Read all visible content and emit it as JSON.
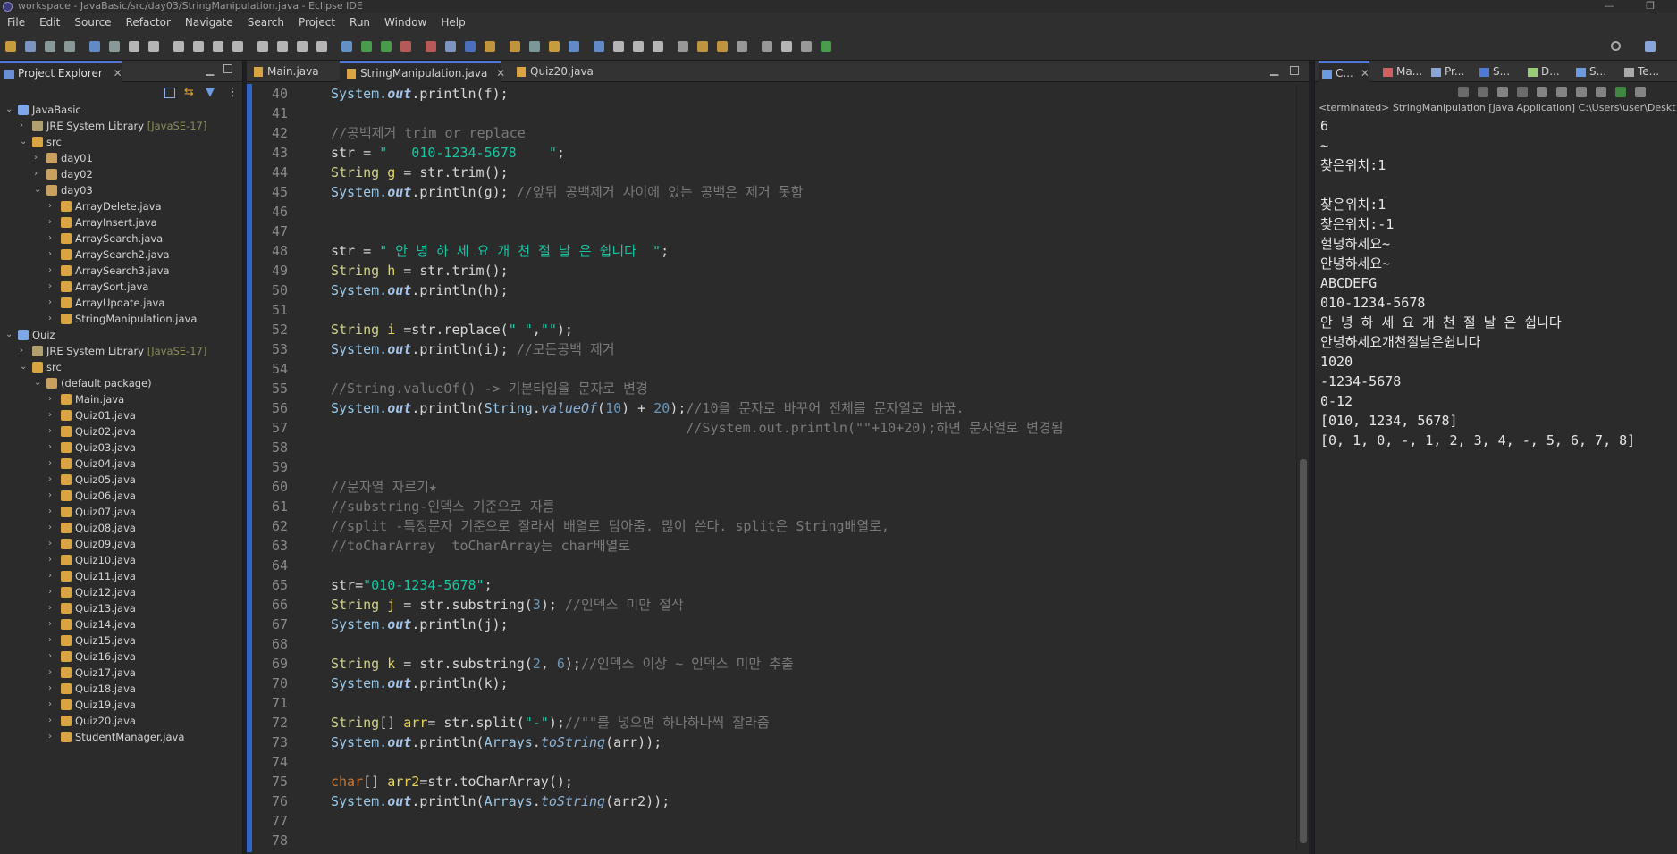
{
  "window": {
    "title": "workspace - JavaBasic/src/day03/StringManipulation.java - Eclipse IDE",
    "minimize_glyph": "—",
    "restore_glyph": "❐"
  },
  "menu": [
    "File",
    "Edit",
    "Source",
    "Refactor",
    "Navigate",
    "Search",
    "Project",
    "Run",
    "Window",
    "Help"
  ],
  "project_explorer": {
    "title": "Project Explorer",
    "tree": [
      {
        "label": "JavaBasic",
        "indent": 0,
        "arrow": "v",
        "icon": "project"
      },
      {
        "label": "JRE System Library",
        "suffix": "[JavaSE-17]",
        "indent": 1,
        "arrow": ">",
        "icon": "library"
      },
      {
        "label": "src",
        "indent": 1,
        "arrow": "v",
        "icon": "folder"
      },
      {
        "label": "day01",
        "indent": 2,
        "arrow": ">",
        "icon": "package"
      },
      {
        "label": "day02",
        "indent": 2,
        "arrow": ">",
        "icon": "package"
      },
      {
        "label": "day03",
        "indent": 2,
        "arrow": "v",
        "icon": "package"
      },
      {
        "label": "ArrayDelete.java",
        "indent": 3,
        "arrow": ">",
        "icon": "java"
      },
      {
        "label": "ArrayInsert.java",
        "indent": 3,
        "arrow": ">",
        "icon": "java"
      },
      {
        "label": "ArraySearch.java",
        "indent": 3,
        "arrow": ">",
        "icon": "java"
      },
      {
        "label": "ArraySearch2.java",
        "indent": 3,
        "arrow": ">",
        "icon": "java"
      },
      {
        "label": "ArraySearch3.java",
        "indent": 3,
        "arrow": ">",
        "icon": "java"
      },
      {
        "label": "ArraySort.java",
        "indent": 3,
        "arrow": ">",
        "icon": "java"
      },
      {
        "label": "ArrayUpdate.java",
        "indent": 3,
        "arrow": ">",
        "icon": "java"
      },
      {
        "label": "StringManipulation.java",
        "indent": 3,
        "arrow": ">",
        "icon": "java"
      },
      {
        "label": "Quiz",
        "indent": 0,
        "arrow": "v",
        "icon": "project"
      },
      {
        "label": "JRE System Library",
        "suffix": "[JavaSE-17]",
        "indent": 1,
        "arrow": ">",
        "icon": "library"
      },
      {
        "label": "src",
        "indent": 1,
        "arrow": "v",
        "icon": "folder"
      },
      {
        "label": "(default package)",
        "indent": 2,
        "arrow": "v",
        "icon": "package"
      },
      {
        "label": "Main.java",
        "indent": 3,
        "arrow": ">",
        "icon": "java"
      },
      {
        "label": "Quiz01.java",
        "indent": 3,
        "arrow": ">",
        "icon": "java"
      },
      {
        "label": "Quiz02.java",
        "indent": 3,
        "arrow": ">",
        "icon": "java"
      },
      {
        "label": "Quiz03.java",
        "indent": 3,
        "arrow": ">",
        "icon": "java"
      },
      {
        "label": "Quiz04.java",
        "indent": 3,
        "arrow": ">",
        "icon": "java"
      },
      {
        "label": "Quiz05.java",
        "indent": 3,
        "arrow": ">",
        "icon": "java"
      },
      {
        "label": "Quiz06.java",
        "indent": 3,
        "arrow": ">",
        "icon": "java"
      },
      {
        "label": "Quiz07.java",
        "indent": 3,
        "arrow": ">",
        "icon": "java"
      },
      {
        "label": "Quiz08.java",
        "indent": 3,
        "arrow": ">",
        "icon": "java"
      },
      {
        "label": "Quiz09.java",
        "indent": 3,
        "arrow": ">",
        "icon": "java"
      },
      {
        "label": "Quiz10.java",
        "indent": 3,
        "arrow": ">",
        "icon": "java"
      },
      {
        "label": "Quiz11.java",
        "indent": 3,
        "arrow": ">",
        "icon": "java"
      },
      {
        "label": "Quiz12.java",
        "indent": 3,
        "arrow": ">",
        "icon": "java"
      },
      {
        "label": "Quiz13.java",
        "indent": 3,
        "arrow": ">",
        "icon": "java"
      },
      {
        "label": "Quiz14.java",
        "indent": 3,
        "arrow": ">",
        "icon": "java"
      },
      {
        "label": "Quiz15.java",
        "indent": 3,
        "arrow": ">",
        "icon": "java"
      },
      {
        "label": "Quiz16.java",
        "indent": 3,
        "arrow": ">",
        "icon": "java"
      },
      {
        "label": "Quiz17.java",
        "indent": 3,
        "arrow": ">",
        "icon": "java"
      },
      {
        "label": "Quiz18.java",
        "indent": 3,
        "arrow": ">",
        "icon": "java"
      },
      {
        "label": "Quiz19.java",
        "indent": 3,
        "arrow": ">",
        "icon": "java"
      },
      {
        "label": "Quiz20.java",
        "indent": 3,
        "arrow": ">",
        "icon": "java"
      },
      {
        "label": "StudentManager.java",
        "indent": 3,
        "arrow": ">",
        "icon": "java"
      }
    ]
  },
  "editor": {
    "tabs": [
      {
        "label": "Main.java",
        "active": false
      },
      {
        "label": "StringManipulation.java",
        "active": true
      },
      {
        "label": "Quiz20.java",
        "active": false
      }
    ],
    "lines": [
      {
        "n": "40",
        "segs": [
          [
            "o",
            "System."
          ],
          [
            "out",
            "out"
          ],
          [
            "d",
            ".println(f);"
          ]
        ]
      },
      {
        "n": "41",
        "segs": []
      },
      {
        "n": "42",
        "segs": [
          [
            "c",
            "//공백제거 trim or replace"
          ]
        ]
      },
      {
        "n": "43",
        "segs": [
          [
            "d",
            "str = "
          ],
          [
            "s",
            "\"   010-1234-5678    \""
          ],
          [
            "d",
            ";"
          ]
        ]
      },
      {
        "n": "44",
        "segs": [
          [
            "t",
            "String"
          ],
          [
            "d",
            " "
          ],
          [
            "v",
            "g"
          ],
          [
            "d",
            " = str.trim();"
          ]
        ]
      },
      {
        "n": "45",
        "segs": [
          [
            "o",
            "System."
          ],
          [
            "out",
            "out"
          ],
          [
            "d",
            ".println(g); "
          ],
          [
            "c",
            "//앞뒤 공백제거 사이에 있는 공백은 제거 못함"
          ]
        ]
      },
      {
        "n": "46",
        "segs": []
      },
      {
        "n": "47",
        "segs": []
      },
      {
        "n": "48",
        "segs": [
          [
            "d",
            "str = "
          ],
          [
            "s",
            "\" 안 녕 하 세 요 개 천 절 날 은 쉽니다  \""
          ],
          [
            "d",
            ";"
          ]
        ]
      },
      {
        "n": "49",
        "segs": [
          [
            "t",
            "String"
          ],
          [
            "d",
            " "
          ],
          [
            "v",
            "h"
          ],
          [
            "d",
            " = str.trim();"
          ]
        ]
      },
      {
        "n": "50",
        "segs": [
          [
            "o",
            "System."
          ],
          [
            "out",
            "out"
          ],
          [
            "d",
            ".println(h);"
          ]
        ]
      },
      {
        "n": "51",
        "segs": []
      },
      {
        "n": "52",
        "segs": [
          [
            "t",
            "String"
          ],
          [
            "d",
            " "
          ],
          [
            "v",
            "i"
          ],
          [
            "d",
            " =str.replace("
          ],
          [
            "s",
            "\" \""
          ],
          [
            "d",
            ","
          ],
          [
            "s",
            "\"\""
          ],
          [
            "d",
            ");"
          ]
        ]
      },
      {
        "n": "53",
        "segs": [
          [
            "o",
            "System."
          ],
          [
            "out",
            "out"
          ],
          [
            "d",
            ".println(i); "
          ],
          [
            "c",
            "//모든공백 제거"
          ]
        ]
      },
      {
        "n": "54",
        "segs": []
      },
      {
        "n": "55",
        "segs": [
          [
            "c",
            "//String.valueOf() -> 기본타입을 문자로 변경"
          ]
        ]
      },
      {
        "n": "56",
        "segs": [
          [
            "o",
            "System."
          ],
          [
            "out",
            "out"
          ],
          [
            "d",
            ".println("
          ],
          [
            "k",
            "String"
          ],
          [
            "d",
            "."
          ],
          [
            "m",
            "valueOf"
          ],
          [
            "d",
            "("
          ],
          [
            "num",
            "10"
          ],
          [
            "d",
            ") + "
          ],
          [
            "num",
            "20"
          ],
          [
            "d",
            ");"
          ],
          [
            "c",
            "//10을 문자로 바꾸어 전체를 문자열로 바꿈."
          ]
        ]
      },
      {
        "n": "57",
        "segs": [
          [
            "d",
            "                                            "
          ],
          [
            "c",
            "//System.out.println(\"\"+10+20);하면 문자열로 변경됨"
          ]
        ]
      },
      {
        "n": "58",
        "segs": []
      },
      {
        "n": "59",
        "segs": []
      },
      {
        "n": "60",
        "segs": [
          [
            "c",
            "//문자열 자르기★"
          ]
        ]
      },
      {
        "n": "61",
        "segs": [
          [
            "c",
            "//substring-인덱스 기준으로 자름"
          ]
        ]
      },
      {
        "n": "62",
        "segs": [
          [
            "c",
            "//split -특정문자 기준으로 잘라서 배열로 담아줌. 많이 쓴다. split은 String배열로,"
          ]
        ]
      },
      {
        "n": "63",
        "segs": [
          [
            "c",
            "//toCharArray  toCharArray는 char배열로"
          ]
        ]
      },
      {
        "n": "64",
        "segs": []
      },
      {
        "n": "65",
        "segs": [
          [
            "d",
            "str="
          ],
          [
            "s",
            "\"010-1234-5678\""
          ],
          [
            "d",
            ";"
          ]
        ]
      },
      {
        "n": "66",
        "segs": [
          [
            "t",
            "String"
          ],
          [
            "d",
            " "
          ],
          [
            "v",
            "j"
          ],
          [
            "d",
            " = str.substring("
          ],
          [
            "num",
            "3"
          ],
          [
            "d",
            "); "
          ],
          [
            "c",
            "//인덱스 미만 절삭"
          ]
        ]
      },
      {
        "n": "67",
        "segs": [
          [
            "o",
            "System."
          ],
          [
            "out",
            "out"
          ],
          [
            "d",
            ".println(j);"
          ]
        ]
      },
      {
        "n": "68",
        "segs": []
      },
      {
        "n": "69",
        "segs": [
          [
            "t",
            "String"
          ],
          [
            "d",
            " "
          ],
          [
            "v",
            "k"
          ],
          [
            "d",
            " = str.substring("
          ],
          [
            "num",
            "2"
          ],
          [
            "d",
            ", "
          ],
          [
            "num",
            "6"
          ],
          [
            "d",
            ");"
          ],
          [
            "c",
            "//인덱스 이상 ~ 인덱스 미만 추출"
          ]
        ]
      },
      {
        "n": "70",
        "segs": [
          [
            "o",
            "System."
          ],
          [
            "out",
            "out"
          ],
          [
            "d",
            ".println(k);"
          ]
        ]
      },
      {
        "n": "71",
        "segs": []
      },
      {
        "n": "72",
        "segs": [
          [
            "t",
            "String"
          ],
          [
            "d",
            "[] "
          ],
          [
            "v",
            "arr"
          ],
          [
            "d",
            "= str.split("
          ],
          [
            "s",
            "\"-\""
          ],
          [
            "d",
            ");"
          ],
          [
            "c",
            "//\"\"를 넣으면 하나하나씩 잘라줌"
          ]
        ]
      },
      {
        "n": "73",
        "segs": [
          [
            "o",
            "System."
          ],
          [
            "out",
            "out"
          ],
          [
            "d",
            ".println("
          ],
          [
            "k",
            "Arrays"
          ],
          [
            "d",
            "."
          ],
          [
            "m",
            "toString"
          ],
          [
            "d",
            "(arr));"
          ]
        ]
      },
      {
        "n": "74",
        "segs": []
      },
      {
        "n": "75",
        "segs": [
          [
            "kw",
            "char"
          ],
          [
            "d",
            "[] "
          ],
          [
            "v",
            "arr2"
          ],
          [
            "d",
            "=str.toCharArray();"
          ]
        ]
      },
      {
        "n": "76",
        "segs": [
          [
            "o",
            "System."
          ],
          [
            "out",
            "out"
          ],
          [
            "d",
            ".println("
          ],
          [
            "k",
            "Arrays"
          ],
          [
            "d",
            "."
          ],
          [
            "m",
            "toString"
          ],
          [
            "d",
            "(arr2));"
          ]
        ]
      },
      {
        "n": "77",
        "segs": []
      },
      {
        "n": "78",
        "segs": []
      }
    ]
  },
  "console": {
    "tabs": [
      "C...",
      "Ma...",
      "Pr...",
      "S...",
      "D...",
      "S...",
      "Te..."
    ],
    "header": "<terminated> StringManipulation [Java Application] C:\\Users\\user\\Deskt",
    "output": [
      "6",
      "~",
      "찾은위치:1",
      "",
      "찾은위치:1",
      "찾은위치:-1",
      "헐녕하세요~",
      "안녕하세요~",
      "ABCDEFG",
      "010-1234-5678",
      "안 녕 하 세 요 개 천 절 날 은 쉽니다",
      "안녕하세요개천절날은쉽니다",
      "1020",
      "-1234-5678",
      "0-12",
      "[010, 1234, 5678]",
      "[0, 1, 0, -, 1, 2, 3, 4, -, 5, 6, 7, 8]"
    ]
  },
  "colors": {
    "accent": "#4e7ad6",
    "string": "#17c6a3",
    "comment": "#7a7a7a",
    "keyword": "#cc7832",
    "type": "#cfd18a",
    "number": "#6897bb"
  }
}
